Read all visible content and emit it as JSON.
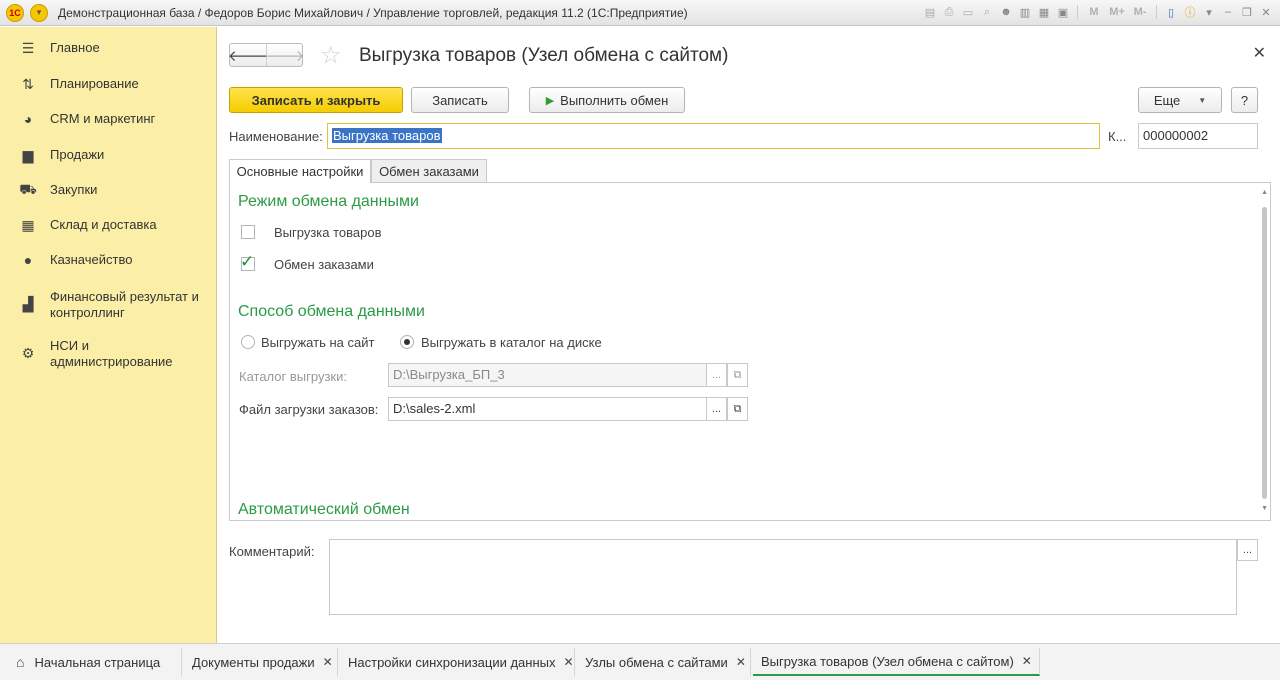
{
  "window": {
    "title": "Демонстрационная база / Федоров Борис Михайлович / Управление торговлей, редакция 11.2  (1С:Предприятие)",
    "toolbar_m_labels": [
      "M",
      "M+",
      "M-"
    ]
  },
  "sidebar": {
    "items": [
      {
        "label": "Главное",
        "icon": "menu-icon"
      },
      {
        "label": "Планирование",
        "icon": "planning-icon"
      },
      {
        "label": "CRM и маркетинг",
        "icon": "pie-chart-icon"
      },
      {
        "label": "Продажи",
        "icon": "bag-icon"
      },
      {
        "label": "Закупки",
        "icon": "cart-icon"
      },
      {
        "label": "Склад и доставка",
        "icon": "warehouse-icon"
      },
      {
        "label": "Казначейство",
        "icon": "ruble-icon"
      },
      {
        "label": "Финансовый результат и контроллинг",
        "icon": "bar-chart-icon"
      },
      {
        "label": "НСИ и администрирование",
        "icon": "gear-icon"
      }
    ]
  },
  "form": {
    "title": "Выгрузка товаров (Узел обмена с сайтом)",
    "buttons": {
      "save_close": "Записать и закрыть",
      "save": "Записать",
      "run_exchange": "Выполнить обмен",
      "more": "Еще",
      "help": "?"
    },
    "name_label": "Наименование:",
    "name_value": "Выгрузка товаров",
    "code_label": "К...",
    "code_value": "000000002",
    "tabs": [
      "Основные настройки",
      "Обмен заказами"
    ],
    "sections": {
      "mode": "Режим обмена данными",
      "method": "Способ обмена данными",
      "auto": "Автоматический обмен"
    },
    "checkboxes": [
      {
        "label": "Выгрузка товаров",
        "checked": false
      },
      {
        "label": "Обмен заказами",
        "checked": true
      }
    ],
    "radios": [
      {
        "label": "Выгружать на сайт",
        "selected": false
      },
      {
        "label": "Выгружать в каталог на диске",
        "selected": true
      }
    ],
    "catalog_label": "Каталог выгрузки:",
    "catalog_value": "D:\\Выгрузка_БП_3",
    "orders_file_label": "Файл загрузки заказов:",
    "orders_file_value": "D:\\sales-2.xml",
    "comment_label": "Комментарий:",
    "ellipsis": "...",
    "open_glyph": "⧉"
  },
  "bottom_tabs": [
    {
      "label": "Начальная страница",
      "closable": false
    },
    {
      "label": "Документы продажи",
      "closable": true
    },
    {
      "label": "Настройки синхронизации данных",
      "closable": true
    },
    {
      "label": "Узлы обмена с сайтами",
      "closable": true
    },
    {
      "label": "Выгрузка товаров (Узел обмена с сайтом)",
      "closable": true,
      "active": true
    }
  ]
}
